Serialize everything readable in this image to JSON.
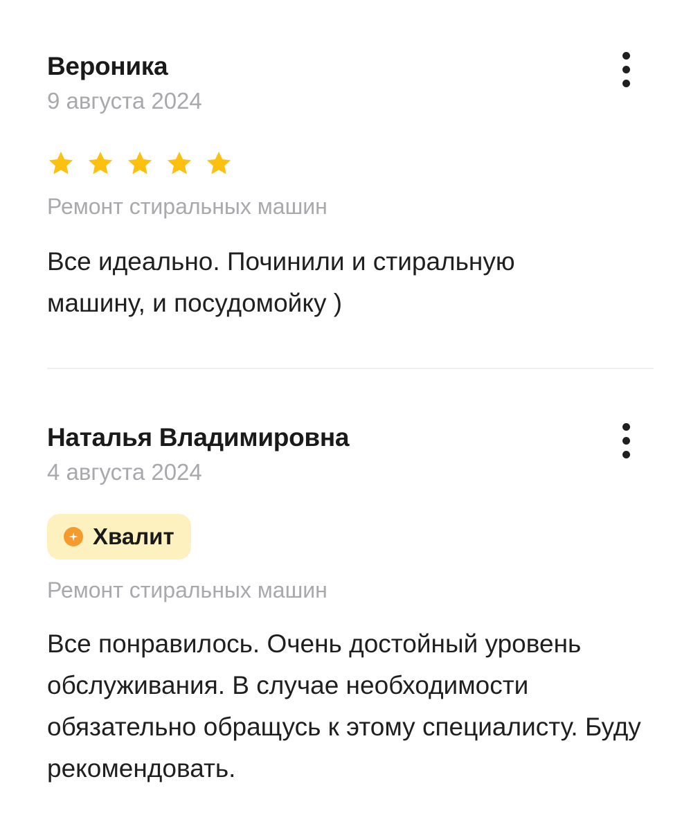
{
  "reviews": [
    {
      "author": "Вероника",
      "date": "9 августа 2024",
      "rating": 5,
      "category": "Ремонт стиральных машин",
      "text": "Все идеально. Починили и стиральную машину, и посудомойку )"
    },
    {
      "author": "Наталья Владимировна",
      "date": "4 августа 2024",
      "badge": "Хвалит",
      "category": "Ремонт стиральных машин",
      "text": "Все понравилось. Очень достойный уровень обслуживания. В случае необходимости обязательно обращусь к этому специалисту. Буду рекомендовать."
    }
  ],
  "colors": {
    "star": "#fcc010",
    "badge_bg": "#fdf1bf",
    "badge_icon": "#f59a2c",
    "muted_text": "#a8a8ad"
  },
  "icons": {
    "more": "vertical-dots-icon",
    "star": "star-icon",
    "praise": "plus-circle-icon"
  }
}
